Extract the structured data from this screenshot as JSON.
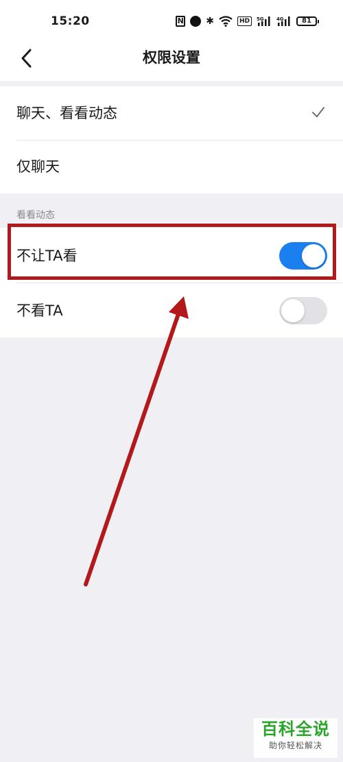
{
  "status_bar": {
    "time": "15:20",
    "battery": "81",
    "hd_label": "HD",
    "network_labels": [
      "5G",
      "4G"
    ]
  },
  "nav": {
    "title": "权限设置"
  },
  "permissions": {
    "items": [
      {
        "label": "聊天、看看动态",
        "selected": true
      },
      {
        "label": "仅聊天",
        "selected": false
      }
    ]
  },
  "moments": {
    "section_label": "看看动态",
    "items": [
      {
        "label": "不让TA看",
        "enabled": true
      },
      {
        "label": "不看TA",
        "enabled": false
      }
    ]
  },
  "colors": {
    "accent": "#1b80ef",
    "annotation": "#b3191b",
    "background": "#f0eff4"
  },
  "watermark": {
    "title": "百科全说",
    "subtitle": "助你轻松解决"
  }
}
